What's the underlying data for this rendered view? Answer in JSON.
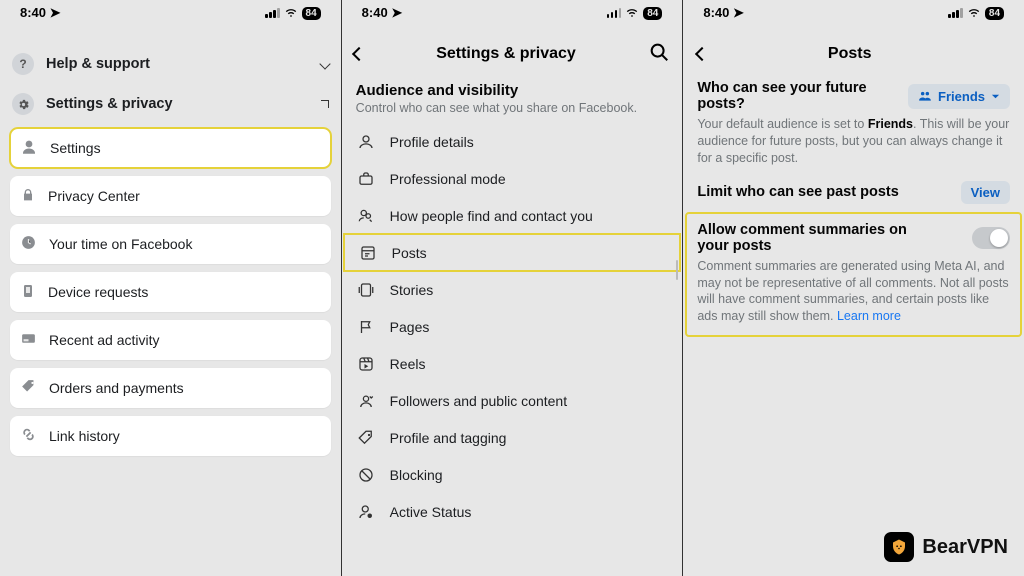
{
  "status": {
    "time": "8:40",
    "battery": "84"
  },
  "screen1": {
    "help_support": "Help & support",
    "settings_privacy": "Settings & privacy",
    "items": [
      "Settings",
      "Privacy Center",
      "Your time on Facebook",
      "Device requests",
      "Recent ad activity",
      "Orders and payments",
      "Link history"
    ]
  },
  "screen2": {
    "title": "Settings & privacy",
    "section_title": "Audience and visibility",
    "section_sub": "Control who can see what you share on Facebook.",
    "items": [
      "Profile details",
      "Professional mode",
      "How people find and contact you",
      "Posts",
      "Stories",
      "Pages",
      "Reels",
      "Followers and public content",
      "Profile and tagging",
      "Blocking",
      "Active Status"
    ]
  },
  "screen3": {
    "title": "Posts",
    "future_posts_label": "Who can see your future posts?",
    "friends_label": "Friends",
    "future_desc_pre": "Your default audience is set to ",
    "future_desc_bold": "Friends",
    "future_desc_post": ". This will be your audience for future posts, but you can always change it for a specific post.",
    "limit_label": "Limit who can see past posts",
    "view_label": "View",
    "allow_label": "Allow comment summaries on your posts",
    "allow_desc": "Comment summaries are generated using Meta AI, and may not be representative of all comments. Not all posts will have comment summaries, and certain posts like ads may still show them. ",
    "learn_more": "Learn more"
  },
  "watermark": "BearVPN"
}
